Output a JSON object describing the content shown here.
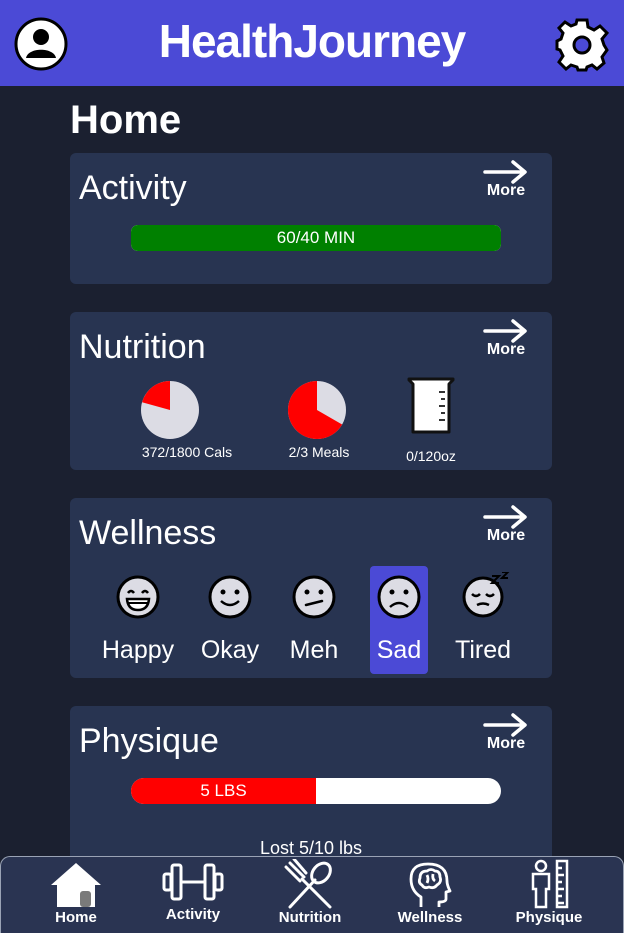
{
  "header": {
    "title": "HealthJourney",
    "profile_icon": "user-circle-icon",
    "settings_icon": "gear-icon",
    "accent_color": "#4b4ad6"
  },
  "page": {
    "title": "Home"
  },
  "more_label": "More",
  "activity": {
    "title": "Activity",
    "progress_text": "60/40 MIN",
    "progress_fraction": 1.0,
    "bar_color": "#008000"
  },
  "nutrition": {
    "title": "Nutrition",
    "calories": {
      "label": "372/1800 Cals",
      "fraction": 0.2067
    },
    "meals": {
      "label": "2/3 Meals",
      "fraction": 0.6667
    },
    "water": {
      "label": "0/120oz",
      "fraction": 0,
      "icon": "beaker-icon"
    },
    "fill_color": "#ff0000"
  },
  "wellness": {
    "title": "Wellness",
    "moods": [
      {
        "label": "Happy",
        "icon": "happy-face-icon",
        "selected": false
      },
      {
        "label": "Okay",
        "icon": "smile-face-icon",
        "selected": false
      },
      {
        "label": "Meh",
        "icon": "meh-face-icon",
        "selected": false
      },
      {
        "label": "Sad",
        "icon": "sad-face-icon",
        "selected": true
      },
      {
        "label": "Tired",
        "icon": "sleepy-face-icon",
        "selected": false
      }
    ]
  },
  "physique": {
    "title": "Physique",
    "progress_text": "5 LBS",
    "progress_fraction": 0.5,
    "status_text": "Lost 5/10 lbs",
    "bar_color": "#ff0000"
  },
  "nav": {
    "items": [
      {
        "label": "Home",
        "icon": "home-icon",
        "active": true
      },
      {
        "label": "Activity",
        "icon": "dumbbell-icon",
        "active": false
      },
      {
        "label": "Nutrition",
        "icon": "fork-spoon-icon",
        "active": false
      },
      {
        "label": "Wellness",
        "icon": "head-brain-icon",
        "active": false
      },
      {
        "label": "Physique",
        "icon": "body-measure-icon",
        "active": false
      }
    ]
  }
}
